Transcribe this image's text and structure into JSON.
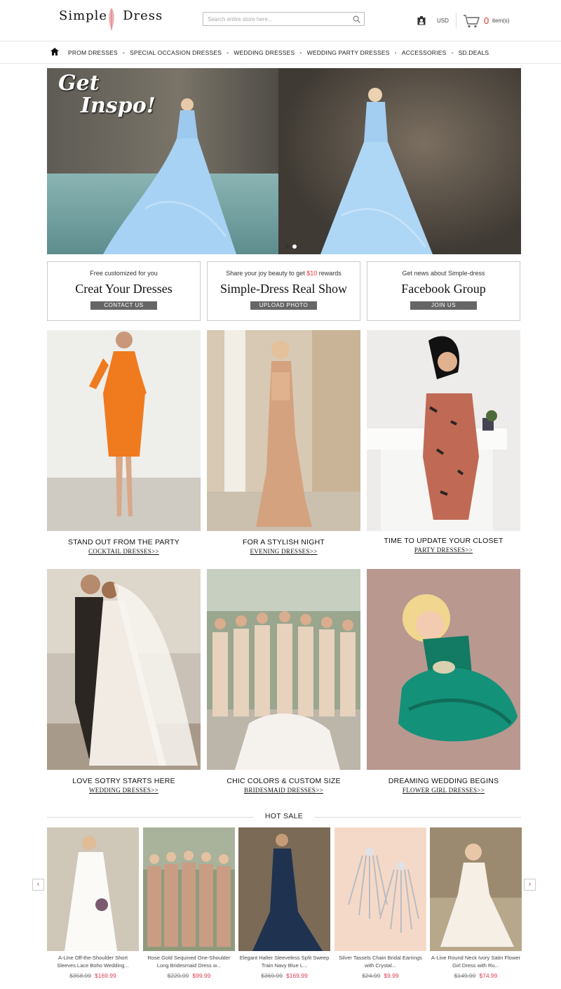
{
  "header": {
    "logo_word1": "Simple",
    "logo_word2": "Dress",
    "search_placeholder": "Search entire store here...",
    "currency": "USD",
    "cart_count": "0",
    "cart_items_label": "item(s)"
  },
  "nav": {
    "items": [
      "PROM DRESSES",
      "SPECIAL OCCASION DRESSES",
      "WEDDING DRESSES",
      "WEDDING PARTY DRESSES",
      "ACCESSORIES",
      "SD.DEALS"
    ],
    "separator": "•"
  },
  "hero": {
    "line1": "Get",
    "line2": "Inspo!"
  },
  "info_boxes": [
    {
      "small": "Free customized for you",
      "big": "Creat Your Dresses",
      "button": "CONTACT US"
    },
    {
      "small_pre": "Share your joy beauty to get ",
      "small_hl": "$10",
      "small_post": " rewards",
      "big": "Simple-Dress Real Show",
      "button": "UPLOAD PHOTO"
    },
    {
      "small": "Get news about Simple-dress",
      "big": "Facebook Group",
      "button": "JOIN US"
    }
  ],
  "categories": [
    {
      "title": "STAND OUT FROM THE PARTY",
      "link": "COCKTAIL DRESSES>>"
    },
    {
      "title": "FOR A STYLISH NIGHT",
      "link": "EVENING DRESSES>>"
    },
    {
      "title": "TIME TO UPDATE YOUR CLOSET",
      "link": "PARTY DRESSES>>"
    },
    {
      "title": "LOVE SOTRY STARTS HERE",
      "link": "WEDDING DRESSES>>"
    },
    {
      "title": "CHIC COLORS & CUSTOM SIZE",
      "link": "BRIDESMAID DRESSES>>"
    },
    {
      "title": "DREAMING WEDDING BEGINS",
      "link": "FLOWER GIRL DRESSES>>"
    }
  ],
  "hot_sale": {
    "title": "HOT SALE",
    "prev": "‹",
    "next": "›",
    "products": [
      {
        "name1": "A-Line Off-the-Shoulder Short",
        "name2": "Sleeves Lace Boho Wedding...",
        "old": "$358.99",
        "new": "$169.99"
      },
      {
        "name1": "Rose Gold Sequined One-Shoulder",
        "name2": "Long Bridesmaid Dress w...",
        "old": "$229.99",
        "new": "$99.99"
      },
      {
        "name1": "Elegant Halter Sleeveless Split Sweep",
        "name2": "Train Navy Blue L...",
        "old": "$369.99",
        "new": "$169.99"
      },
      {
        "name1": "Silver Tassels Chain Bridal Earrings",
        "name2": "with Crystal...",
        "old": "$24.99",
        "new": "$9.99"
      },
      {
        "name1": "A-Line Round Neck Ivory Satin Flower",
        "name2": "Girl Dress with Ru...",
        "old": "$149.99",
        "new": "$74.99"
      }
    ]
  },
  "colors": {
    "accent_red": "#e0405a",
    "button_gray": "#666666"
  }
}
